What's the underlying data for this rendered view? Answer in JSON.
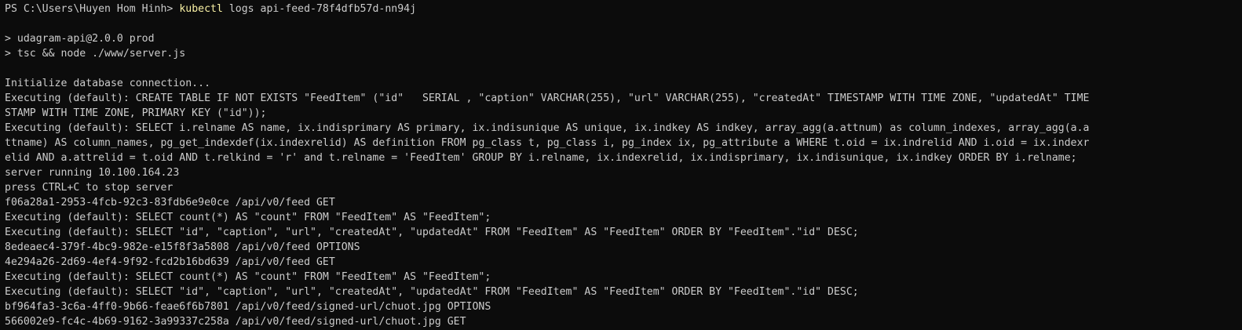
{
  "prompt": {
    "path": "PS C:\\Users\\Huyen Hom Hinh> ",
    "command": "kubectl",
    "args": " logs api-feed-78f4dfb57d-nn94j"
  },
  "lines": [
    "",
    "> udagram-api@2.0.0 prod",
    "> tsc && node ./www/server.js",
    "",
    "Initialize database connection...",
    "Executing (default): CREATE TABLE IF NOT EXISTS \"FeedItem\" (\"id\"   SERIAL , \"caption\" VARCHAR(255), \"url\" VARCHAR(255), \"createdAt\" TIMESTAMP WITH TIME ZONE, \"updatedAt\" TIME",
    "STAMP WITH TIME ZONE, PRIMARY KEY (\"id\"));",
    "Executing (default): SELECT i.relname AS name, ix.indisprimary AS primary, ix.indisunique AS unique, ix.indkey AS indkey, array_agg(a.attnum) as column_indexes, array_agg(a.a",
    "ttname) AS column_names, pg_get_indexdef(ix.indexrelid) AS definition FROM pg_class t, pg_class i, pg_index ix, pg_attribute a WHERE t.oid = ix.indrelid AND i.oid = ix.indexr",
    "elid AND a.attrelid = t.oid AND t.relkind = 'r' and t.relname = 'FeedItem' GROUP BY i.relname, ix.indexrelid, ix.indisprimary, ix.indisunique, ix.indkey ORDER BY i.relname;",
    "server running 10.100.164.23",
    "press CTRL+C to stop server",
    "f06a28a1-2953-4fcb-92c3-83fdb6e9e0ce /api/v0/feed GET",
    "Executing (default): SELECT count(*) AS \"count\" FROM \"FeedItem\" AS \"FeedItem\";",
    "Executing (default): SELECT \"id\", \"caption\", \"url\", \"createdAt\", \"updatedAt\" FROM \"FeedItem\" AS \"FeedItem\" ORDER BY \"FeedItem\".\"id\" DESC;",
    "8edeaec4-379f-4bc9-982e-e15f8f3a5808 /api/v0/feed OPTIONS",
    "4e294a26-2d69-4ef4-9f92-fcd2b16bd639 /api/v0/feed GET",
    "Executing (default): SELECT count(*) AS \"count\" FROM \"FeedItem\" AS \"FeedItem\";",
    "Executing (default): SELECT \"id\", \"caption\", \"url\", \"createdAt\", \"updatedAt\" FROM \"FeedItem\" AS \"FeedItem\" ORDER BY \"FeedItem\".\"id\" DESC;",
    "bf964fa3-3c6a-4ff0-9b66-feae6f6b7801 /api/v0/feed/signed-url/chuot.jpg OPTIONS",
    "566002e9-fc4c-4b69-9162-3a99337c258a /api/v0/feed/signed-url/chuot.jpg GET"
  ],
  "colors": {
    "background": "#0c0c0c",
    "foreground": "#cccccc",
    "command": "#f9f1a5"
  }
}
